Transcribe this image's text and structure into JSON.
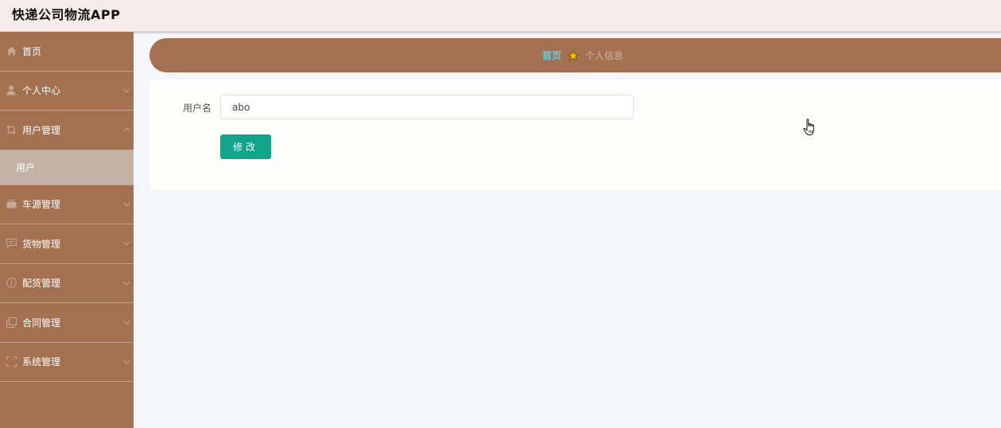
{
  "app": {
    "title": "快递公司物流APP"
  },
  "sidebar": {
    "items": [
      {
        "label": "首页",
        "icon": "home-icon",
        "has_chevron": false
      },
      {
        "label": "个人中心",
        "icon": "user-icon",
        "has_chevron": true
      },
      {
        "label": "用户管理",
        "icon": "crop-icon",
        "has_chevron": true,
        "expanded": true
      },
      {
        "label": "车源管理",
        "icon": "briefcase-icon",
        "has_chevron": true
      },
      {
        "label": "货物管理",
        "icon": "message-icon",
        "has_chevron": true
      },
      {
        "label": "配货管理",
        "icon": "info-icon",
        "has_chevron": true
      },
      {
        "label": "合同管理",
        "icon": "copy-icon",
        "has_chevron": true
      },
      {
        "label": "系统管理",
        "icon": "fullscreen-icon",
        "has_chevron": true
      }
    ],
    "sub_items": [
      {
        "label": "用户",
        "parent": "用户管理",
        "active": true
      }
    ]
  },
  "breadcrumb": {
    "home": "首页",
    "separator_icon": "star-icon",
    "current": "个人信息"
  },
  "form": {
    "username_label": "用户名",
    "username_value": "abo",
    "submit_label": "修改"
  },
  "colors": {
    "sidebar_bg": "#a37050",
    "topbar_bg": "#f5ecea",
    "submenu_active_bg": "#c5b2a6",
    "breadcrumb_home": "#5fd1e3",
    "button_bg": "#12a58a",
    "star": "#f2c200"
  }
}
